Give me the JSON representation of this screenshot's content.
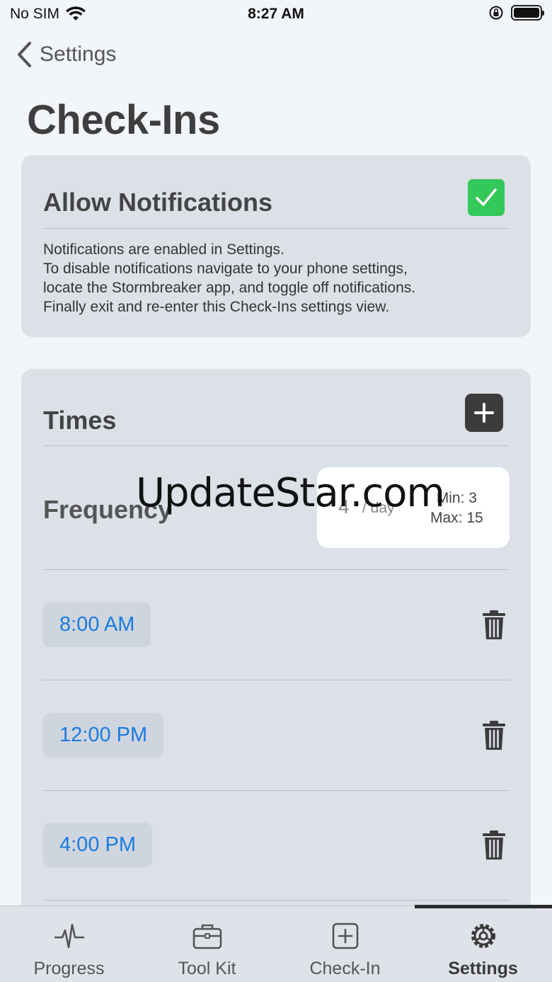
{
  "status_bar": {
    "carrier": "No SIM",
    "time": "8:27 AM"
  },
  "nav": {
    "back_label": "Settings",
    "title": "Check-Ins"
  },
  "notifications": {
    "header": "Allow Notifications",
    "enabled": true,
    "description_lines": [
      "Notifications are enabled in Settings.",
      "To disable notifications navigate to your phone settings,",
      "locate the Stormbreaker app, and toggle off notifications.",
      "Finally exit and re-enter this Check-Ins settings view."
    ]
  },
  "times": {
    "header": "Times",
    "frequency_label": "Frequency",
    "frequency_value": "4",
    "frequency_unit": "/ day",
    "min_label": "Min: 3",
    "max_label": "Max: 15",
    "entries": [
      "8:00 AM",
      "12:00 PM",
      "4:00 PM"
    ]
  },
  "watermark": "UpdateStar.com",
  "tabs": [
    {
      "label": "Progress",
      "icon": "pulse-icon"
    },
    {
      "label": "Tool Kit",
      "icon": "briefcase-icon"
    },
    {
      "label": "Check-In",
      "icon": "plus-square-icon"
    },
    {
      "label": "Settings",
      "icon": "gear-icon",
      "active": true
    }
  ],
  "colors": {
    "accent_blue": "#1a7be0",
    "check_green": "#34c759",
    "card_bg": "#dce1e8"
  }
}
